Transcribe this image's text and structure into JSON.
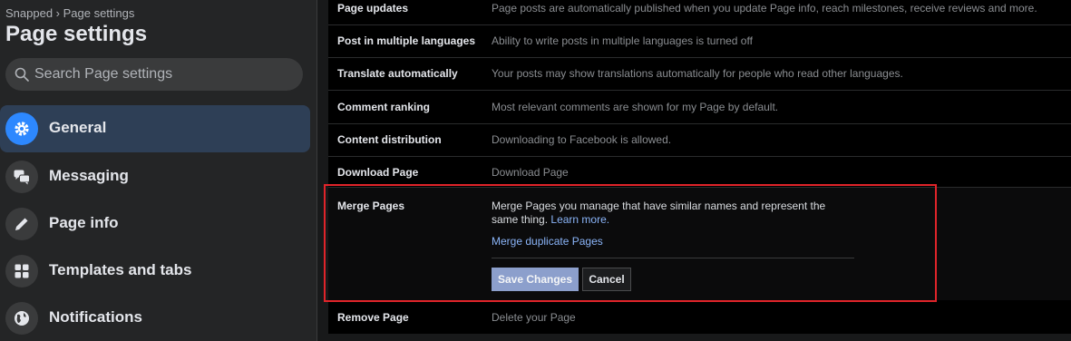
{
  "sidebar": {
    "breadcrumb": "Snapped › Page settings",
    "title": "Page settings",
    "search_placeholder": "Search Page settings",
    "items": [
      {
        "label": "General",
        "icon": "gear-icon",
        "active": true
      },
      {
        "label": "Messaging",
        "icon": "messages-icon",
        "active": false
      },
      {
        "label": "Page info",
        "icon": "pencil-icon",
        "active": false
      },
      {
        "label": "Templates and tabs",
        "icon": "grid-icon",
        "active": false
      },
      {
        "label": "Notifications",
        "icon": "globe-icon",
        "active": false
      }
    ]
  },
  "settings": [
    {
      "label": "Page updates",
      "description": "Page posts are automatically published when you update Page info, reach milestones, receive reviews and more."
    },
    {
      "label": "Post in multiple languages",
      "description": "Ability to write posts in multiple languages is turned off"
    },
    {
      "label": "Translate automatically",
      "description": "Your posts may show translations automatically for people who read other languages."
    },
    {
      "label": "Comment ranking",
      "description": "Most relevant comments are shown for my Page by default."
    },
    {
      "label": "Content distribution",
      "description": "Downloading to Facebook is allowed."
    },
    {
      "label": "Download Page",
      "description": "Download Page"
    }
  ],
  "merge": {
    "label": "Merge Pages",
    "description": "Merge Pages you manage that have similar names and represent the same thing.",
    "learn_more": "Learn more.",
    "link": "Merge duplicate Pages",
    "save_label": "Save Changes",
    "cancel_label": "Cancel"
  },
  "remove": {
    "label": "Remove Page",
    "description": "Delete your Page"
  },
  "colors": {
    "highlight": "#e0242a",
    "accent": "#2d88ff",
    "active_bg": "#2e3f56"
  }
}
